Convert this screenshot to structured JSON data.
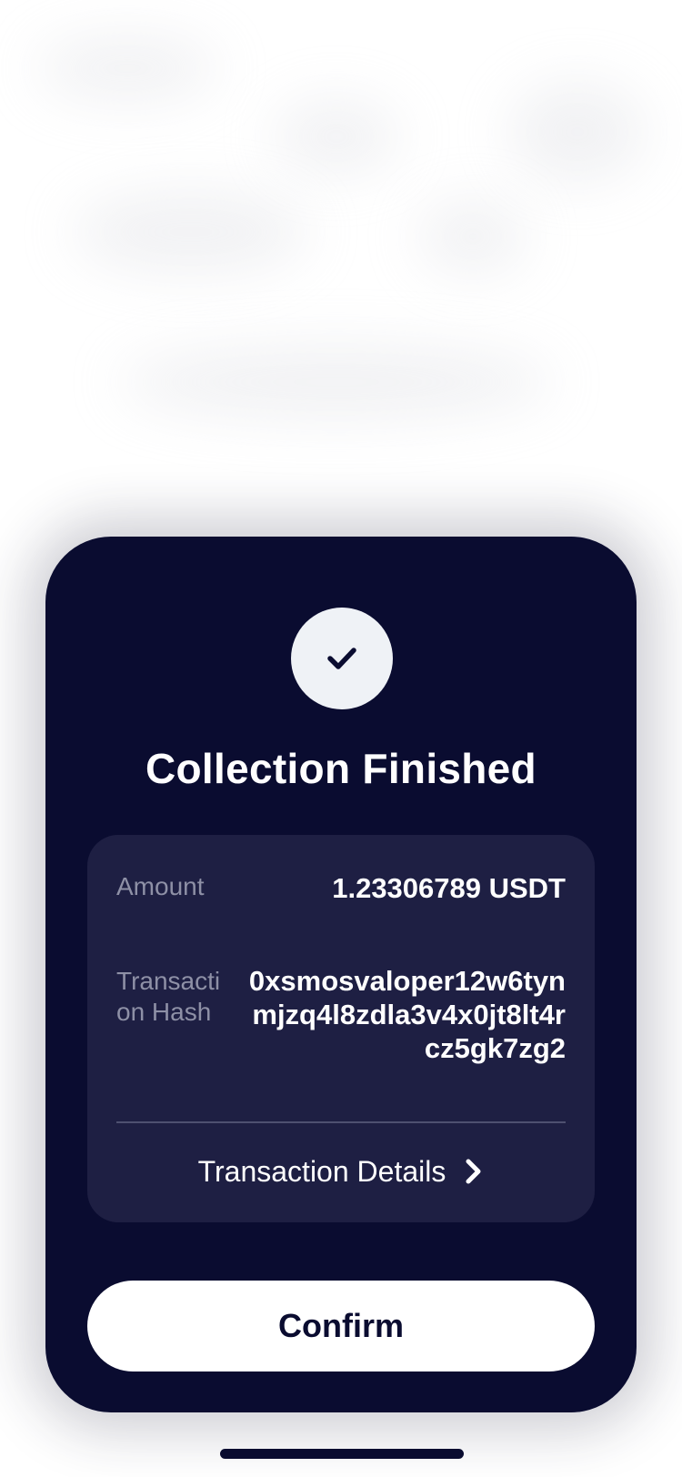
{
  "modal": {
    "title": "Collection Finished",
    "status_icon": "checkmark-icon",
    "details": {
      "amount_label": "Amount",
      "amount_value": "1.23306789 USDT",
      "hash_label": "Transaction Hash",
      "hash_value": "0xsmosvaloper12w6tynmjzq4l8zdla3v4x0jt8lt4rcz5gk7zg2",
      "link_label": "Transaction Details",
      "link_icon": "chevron-right-icon"
    },
    "confirm_label": "Confirm"
  },
  "colors": {
    "modal_background": "#0a0c30",
    "card_background": "#1e1f43",
    "label_text": "#8e90a6",
    "icon_circle": "#eff2f6"
  }
}
